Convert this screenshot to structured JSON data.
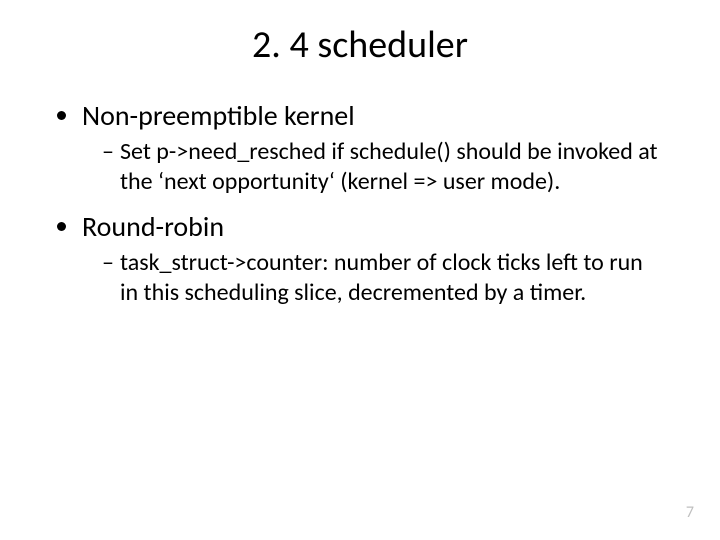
{
  "title": "2. 4 scheduler",
  "bullets": [
    {
      "label": "Non-preemptible kernel",
      "sub": [
        "Set p->need_resched if schedule() should be invoked at the ‘next opportunity‘ (kernel => user mode)."
      ]
    },
    {
      "label": "Round-robin",
      "sub": [
        "task_struct->counter: number of clock ticks left to run in this scheduling slice, decremented by a timer."
      ]
    }
  ],
  "page_number": "7"
}
